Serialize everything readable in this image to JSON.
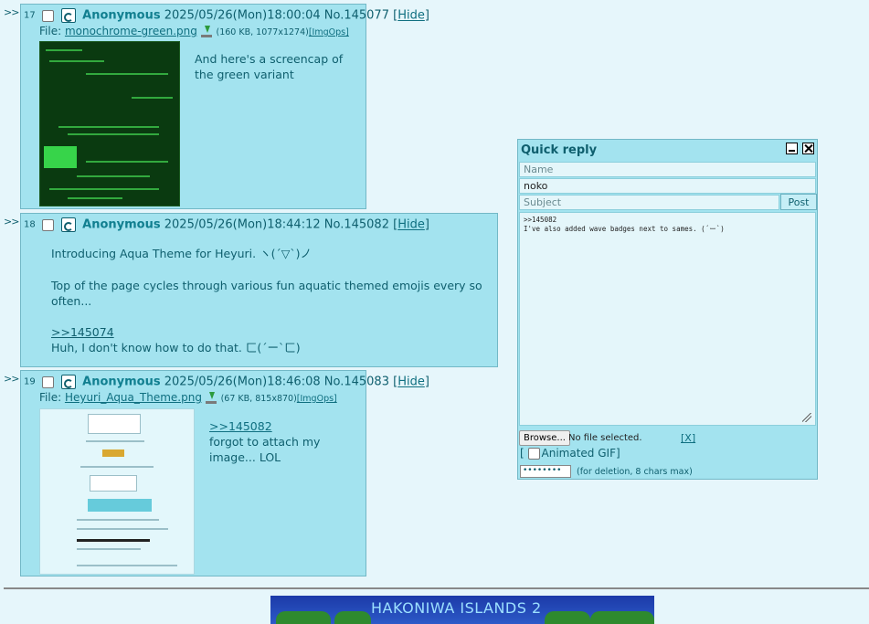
{
  "posts": [
    {
      "num": "17",
      "name": "Anonymous",
      "datetime": "2025/05/26(Mon)18:00:04",
      "no": "No.145077",
      "hide_open": "[",
      "hide": "Hide",
      "hide_close": "]",
      "file_label": "File: ",
      "filename": "monochrome-green.png",
      "fileinfo": "(160 KB, 1077x1274)",
      "imgops": "[ImgOps]",
      "lines": [
        "And here's a screencap of",
        "the green variant"
      ]
    },
    {
      "num": "18",
      "name": "Anonymous",
      "datetime": "2025/05/26(Mon)18:44:12",
      "no": "No.145082",
      "hide_open": "[",
      "hide": "Hide",
      "hide_close": "]",
      "lines": [
        "Introducing Aqua Theme for Heyuri. ヽ(´▽`)ノ",
        "Top of the page cycles through various fun aquatic themed emojis every so often...",
        "Huh, I don't know how to do that. ㄈ(´ー`ㄈ)"
      ],
      "quote": ">>145074"
    },
    {
      "num": "19",
      "name": "Anonymous",
      "datetime": "2025/05/26(Mon)18:46:08",
      "no": "No.145083",
      "hide_open": "[",
      "hide": "Hide",
      "hide_close": "]",
      "file_label": "File: ",
      "filename": "Heyuri_Aqua_Theme.png",
      "fileinfo": "(67 KB, 815x870)",
      "imgops": "[ImgOps]",
      "quote": ">>145082",
      "lines": [
        "forgot to attach my",
        "image... LOL"
      ]
    }
  ],
  "arrows": ">>",
  "quick_reply": {
    "title": "Quick reply",
    "name_placeholder": "Name",
    "email_value": "noko",
    "subject_placeholder": "Subject",
    "post_label": "Post",
    "comment": ">>145082\nI've also added wave badges next to sames. (´ー`)",
    "browse_label": "Browse...",
    "no_file": "No file selected.",
    "clear": "[X]",
    "animated_gif_open": "[",
    "animated_gif": "Animated GIF]",
    "password": "••••••••",
    "password_note": "(for deletion, 8 chars max)"
  },
  "banner": {
    "title": "HAKONIWA ISLANDS 2"
  },
  "colors": {
    "background": "#e6f6fb",
    "post_bg": "#a3e3ef",
    "text": "#0f5f6e",
    "name": "#117f90"
  },
  "icons": [
    "wave-icon",
    "download-icon",
    "minimize-icon",
    "close-icon",
    "resize-grip-icon"
  ]
}
